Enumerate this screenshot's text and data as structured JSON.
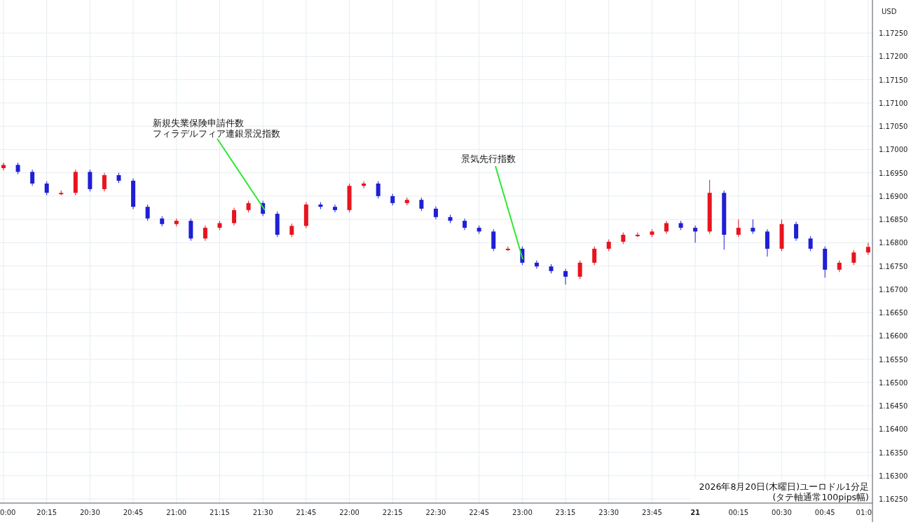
{
  "currency": "USD",
  "chart_data": {
    "type": "candlestick",
    "categories": [
      "0:00",
      null,
      null,
      "20:15",
      null,
      null,
      "20:30",
      null,
      null,
      "20:45",
      null,
      null,
      "21:00",
      null,
      null,
      "21:15",
      null,
      null,
      "21:30",
      null,
      null,
      "21:45",
      null,
      null,
      "22:00",
      null,
      null,
      "22:15",
      null,
      null,
      "22:30",
      null,
      null,
      "22:45",
      null,
      null,
      "23:00",
      null,
      null,
      "23:15",
      null,
      null,
      "23:30",
      null,
      null,
      "23:45",
      null,
      null,
      "21",
      null,
      null,
      "00:15",
      null,
      null,
      "00:30",
      null,
      null,
      "00:45",
      null,
      null,
      "01:0"
    ],
    "ohlc": [
      [
        1.1696,
        1.16972,
        1.16955,
        1.16967
      ],
      [
        1.16967,
        1.16972,
        1.16947,
        1.16952
      ],
      [
        1.16952,
        1.16957,
        1.16922,
        1.16927
      ],
      [
        1.16927,
        1.16932,
        1.16902,
        1.16907
      ],
      [
        1.16907,
        1.16912,
        1.16902,
        1.16907
      ],
      [
        1.16907,
        1.16957,
        1.16902,
        1.16952
      ],
      [
        1.16952,
        1.16957,
        1.1691,
        1.16915
      ],
      [
        1.16915,
        1.1695,
        1.1691,
        1.16945
      ],
      [
        1.16945,
        1.1695,
        1.16928,
        1.16933
      ],
      [
        1.16933,
        1.16938,
        1.16872,
        1.16877
      ],
      [
        1.16877,
        1.16882,
        1.16847,
        1.16852
      ],
      [
        1.16852,
        1.16857,
        1.16835,
        1.1684
      ],
      [
        1.1684,
        1.16852,
        1.16835,
        1.16847
      ],
      [
        1.16847,
        1.16852,
        1.16804,
        1.16809
      ],
      [
        1.16809,
        1.16837,
        1.16804,
        1.16832
      ],
      [
        1.16832,
        1.16847,
        1.16827,
        1.16842
      ],
      [
        1.16842,
        1.16875,
        1.16837,
        1.1687
      ],
      [
        1.1687,
        1.1689,
        1.16865,
        1.16885
      ],
      [
        1.16885,
        1.1689,
        1.16857,
        1.16862
      ],
      [
        1.16862,
        1.16867,
        1.16812,
        1.16817
      ],
      [
        1.16817,
        1.16841,
        1.16812,
        1.16836
      ],
      [
        1.16836,
        1.16887,
        1.16831,
        1.16882
      ],
      [
        1.16882,
        1.16887,
        1.16872,
        1.16877
      ],
      [
        1.16877,
        1.16882,
        1.16865,
        1.1687
      ],
      [
        1.1687,
        1.16927,
        1.16865,
        1.16922
      ],
      [
        1.16922,
        1.16932,
        1.16917,
        1.16927
      ],
      [
        1.16927,
        1.16932,
        1.16895,
        1.169
      ],
      [
        1.169,
        1.16905,
        1.1688,
        1.16885
      ],
      [
        1.16885,
        1.16897,
        1.1688,
        1.16892
      ],
      [
        1.16892,
        1.16897,
        1.16868,
        1.16873
      ],
      [
        1.16873,
        1.16878,
        1.1685,
        1.16855
      ],
      [
        1.16855,
        1.1686,
        1.16842,
        1.16847
      ],
      [
        1.16847,
        1.16852,
        1.16827,
        1.16832
      ],
      [
        1.16832,
        1.16837,
        1.16819,
        1.16824
      ],
      [
        1.16824,
        1.16829,
        1.16782,
        1.16787
      ],
      [
        1.16787,
        1.16792,
        1.16782,
        1.16787
      ],
      [
        1.16787,
        1.16792,
        1.16752,
        1.16757
      ],
      [
        1.16757,
        1.16762,
        1.16744,
        1.16749
      ],
      [
        1.16749,
        1.16754,
        1.16734,
        1.16739
      ],
      [
        1.16739,
        1.16744,
        1.1671,
        1.16727
      ],
      [
        1.16727,
        1.16762,
        1.16722,
        1.16757
      ],
      [
        1.16757,
        1.16792,
        1.16752,
        1.16787
      ],
      [
        1.16787,
        1.16807,
        1.16782,
        1.16802
      ],
      [
        1.16802,
        1.16822,
        1.16797,
        1.16817
      ],
      [
        1.16817,
        1.16822,
        1.16812,
        1.16817
      ],
      [
        1.16817,
        1.16829,
        1.16812,
        1.16824
      ],
      [
        1.16824,
        1.16847,
        1.16819,
        1.16842
      ],
      [
        1.16842,
        1.16847,
        1.16827,
        1.16832
      ],
      [
        1.16832,
        1.16837,
        1.168,
        1.16824
      ],
      [
        1.16824,
        1.16935,
        1.16819,
        1.16907
      ],
      [
        1.16907,
        1.16912,
        1.16785,
        1.16817
      ],
      [
        1.16817,
        1.1685,
        1.16812,
        1.16832
      ],
      [
        1.16832,
        1.1685,
        1.16819,
        1.16824
      ],
      [
        1.16824,
        1.16829,
        1.1677,
        1.16787
      ],
      [
        1.16787,
        1.1685,
        1.16782,
        1.1684
      ],
      [
        1.1684,
        1.16845,
        1.16804,
        1.16809
      ],
      [
        1.16809,
        1.16814,
        1.16782,
        1.16787
      ],
      [
        1.16787,
        1.16792,
        1.16725,
        1.16742
      ],
      [
        1.16742,
        1.16762,
        1.16737,
        1.16757
      ],
      [
        1.16757,
        1.16784,
        1.16752,
        1.16779
      ],
      [
        1.16779,
        1.168,
        1.16774,
        1.16791
      ]
    ],
    "ylim": [
      1.16241,
      1.17321
    ],
    "yticks": [
      {
        "value": 1.1725,
        "label": "1.17250"
      },
      {
        "value": 1.172,
        "label": "1.17200"
      },
      {
        "value": 1.1715,
        "label": "1.17150"
      },
      {
        "value": 1.171,
        "label": "1.17100"
      },
      {
        "value": 1.1705,
        "label": "1.17050"
      },
      {
        "value": 1.17,
        "label": "1.17000"
      },
      {
        "value": 1.1695,
        "label": "1.16950"
      },
      {
        "value": 1.169,
        "label": "1.16900"
      },
      {
        "value": 1.1685,
        "label": "1.16850"
      },
      {
        "value": 1.168,
        "label": "1.16800"
      },
      {
        "value": 1.1675,
        "label": "1.16750"
      },
      {
        "value": 1.167,
        "label": "1.16700"
      },
      {
        "value": 1.1665,
        "label": "1.16650"
      },
      {
        "value": 1.166,
        "label": "1.16600"
      },
      {
        "value": 1.1655,
        "label": "1.16550"
      },
      {
        "value": 1.165,
        "label": "1.16500"
      },
      {
        "value": 1.1645,
        "label": "1.16450"
      },
      {
        "value": 1.164,
        "label": "1.16400"
      },
      {
        "value": 1.1635,
        "label": "1.16350"
      },
      {
        "value": 1.163,
        "label": "1.16300"
      },
      {
        "value": 1.1625,
        "label": "1.16250"
      }
    ],
    "annotations": [
      "新規失業保険申請件数",
      "フィラデルフィア連銀景況指数",
      "景気先行指数"
    ],
    "grid": true
  },
  "caption": [
    "2026年8月20日(木曜日)ユーロドル1分足",
    "(タテ軸通常100pips幅)"
  ]
}
